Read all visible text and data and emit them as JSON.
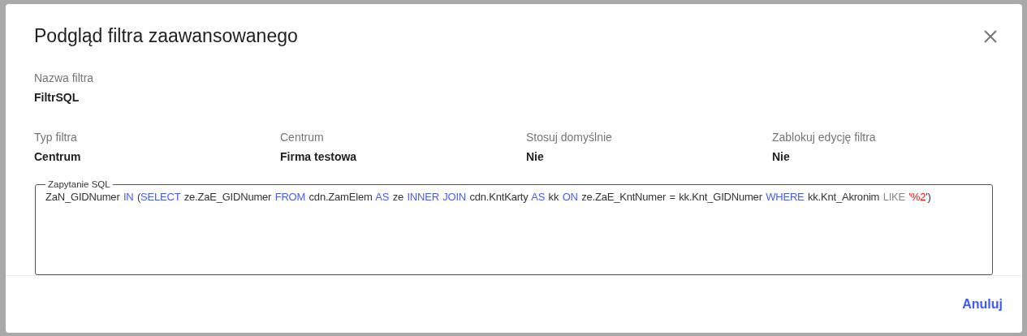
{
  "dialog": {
    "title": "Podgląd filtra zaawansowanego",
    "name_field": {
      "label": "Nazwa filtra",
      "value": "FiltrSQL"
    },
    "fields": [
      {
        "label": "Typ filtra",
        "value": "Centrum"
      },
      {
        "label": "Centrum",
        "value": "Firma testowa"
      },
      {
        "label": "Stosuj domyślnie",
        "value": "Nie"
      },
      {
        "label": "Zablokuj edycję filtra",
        "value": "Nie"
      }
    ],
    "sql": {
      "label": "Zapytanie SQL",
      "tokens": [
        {
          "kind": "plain",
          "text": "ZaN_GIDNumer"
        },
        {
          "kind": "keyword",
          "text": "IN"
        },
        {
          "kind": "plain",
          "text": "("
        },
        {
          "kind": "keyword",
          "text": "SELECT"
        },
        {
          "kind": "plain",
          "text": "ze.ZaE_GIDNumer"
        },
        {
          "kind": "keyword",
          "text": "FROM"
        },
        {
          "kind": "plain",
          "text": "cdn.ZamElem"
        },
        {
          "kind": "keyword",
          "text": "AS"
        },
        {
          "kind": "plain",
          "text": "ze"
        },
        {
          "kind": "keyword",
          "text": "INNER JOIN"
        },
        {
          "kind": "plain",
          "text": "cdn.KntKarty"
        },
        {
          "kind": "keyword",
          "text": "AS"
        },
        {
          "kind": "plain",
          "text": "kk"
        },
        {
          "kind": "keyword",
          "text": "ON"
        },
        {
          "kind": "plain",
          "text": "ze.ZaE_KntNumer = kk.Knt_GIDNumer"
        },
        {
          "kind": "keyword",
          "text": "WHERE"
        },
        {
          "kind": "plain",
          "text": "kk.Knt_Akronim"
        },
        {
          "kind": "operator",
          "text": "LIKE"
        },
        {
          "kind": "string",
          "text": "'%2'"
        },
        {
          "kind": "plain",
          "text": ")"
        }
      ]
    },
    "buttons": [
      {
        "label": "Anuluj"
      }
    ]
  }
}
